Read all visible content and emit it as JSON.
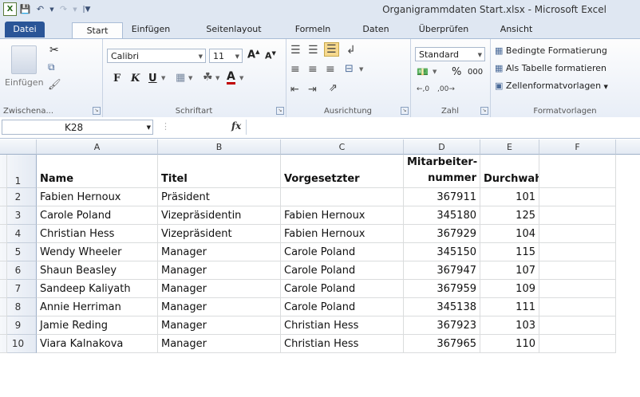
{
  "window": {
    "title": "Organigrammdaten Start.xlsx  -  Microsoft Excel"
  },
  "tabs": [
    "Datei",
    "Start",
    "Einfügen",
    "Seitenlayout",
    "Formeln",
    "Daten",
    "Überprüfen",
    "Ansicht"
  ],
  "ribbon": {
    "clipboard": {
      "paste": "Einfügen",
      "label": "Zwischena..."
    },
    "font": {
      "name": "Calibri",
      "size": "11",
      "label": "Schriftart",
      "bold": "F",
      "italic": "K",
      "underline": "U"
    },
    "alignment": {
      "label": "Ausrichtung"
    },
    "number": {
      "format": "Standard",
      "percent": "%",
      "thousands": "000",
      "label": "Zahl"
    },
    "styles": {
      "conditional": "Bedingte Formatierung",
      "as_table": "Als Tabelle formatieren",
      "cell_styles": "Zellenformatvorlagen",
      "label": "Formatvorlagen"
    }
  },
  "formula_bar": {
    "name_box": "K28",
    "fx": "fx",
    "value": ""
  },
  "columns": [
    "A",
    "B",
    "C",
    "D",
    "E",
    "F"
  ],
  "rows": [
    [
      "Name",
      "Titel",
      "Vorgesetzter",
      "Mitarbeiter-\nnummer",
      "Durchwahl"
    ],
    [
      "Fabien Hernoux",
      "Präsident",
      "",
      "367911",
      "101"
    ],
    [
      "Carole Poland",
      "Vizepräsidentin",
      "Fabien Hernoux",
      "345180",
      "125"
    ],
    [
      "Christian Hess",
      "Vizepräsident",
      "Fabien Hernoux",
      "367929",
      "104"
    ],
    [
      "Wendy Wheeler",
      "Manager",
      "Carole Poland",
      "345150",
      "115"
    ],
    [
      "Shaun Beasley",
      "Manager",
      "Carole Poland",
      "367947",
      "107"
    ],
    [
      "Sandeep Kaliyath",
      "Manager",
      "Carole Poland",
      "367959",
      "109"
    ],
    [
      "Annie Herriman",
      "Manager",
      "Carole Poland",
      "345138",
      "111"
    ],
    [
      "Jamie Reding",
      "Manager",
      "Christian Hess",
      "367923",
      "103"
    ],
    [
      "Viara Kalnakova",
      "Manager",
      "Christian Hess",
      "367965",
      "110"
    ]
  ],
  "row_numbers": [
    "1",
    "2",
    "3",
    "4",
    "5",
    "6",
    "7",
    "8",
    "9",
    "10"
  ],
  "header_d_line1": "Mitarbeiter-",
  "header_d_line2": "nummer"
}
